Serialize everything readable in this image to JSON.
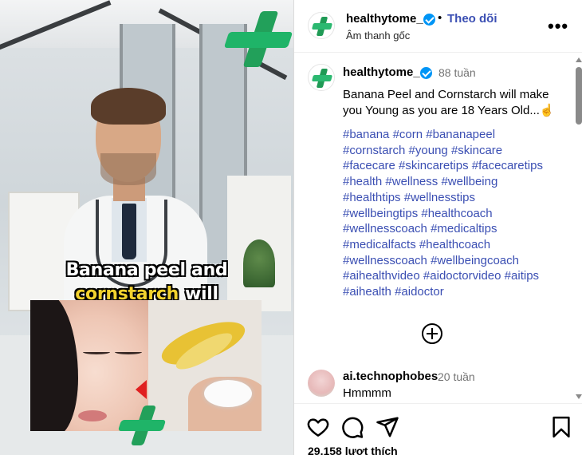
{
  "post": {
    "username": "healthytome_",
    "follow_label": "Theo dõi",
    "audio_label": "Âm thanh gốc",
    "more_label": "•••",
    "separator": "•",
    "caption_time": "88 tuần",
    "caption": "Banana Peel and Cornstarch will make you Young as you are 18 Years Old...☝️",
    "hashtags": [
      "#banana",
      "#corn",
      "#bananapeel",
      "#cornstarch",
      "#young",
      "#skincare",
      "#facecare",
      "#skincaretips",
      "#facecaretips",
      "#health",
      "#wellness",
      "#wellbeing",
      "#healthtips",
      "#wellnesstips",
      "#wellbeingtips",
      "#healthcoach",
      "#wellnesscoach",
      "#medicaltips",
      "#medicalfacts",
      "#healthcoach",
      "#wellnesscoach",
      "#wellbeingcoach",
      "#aihealthvideo",
      "#aidoctorvideo",
      "#aitips",
      "#aihealth",
      "#aidoctor"
    ],
    "likes": "29.158 lượt thích"
  },
  "media_overlay": {
    "line1": "Banana peel and",
    "line2_highlight": "cornstarch",
    "line2_rest": "will"
  },
  "comment": {
    "username": "ai.technophobes",
    "time": "20 tuần",
    "text": "Hmmmm"
  },
  "icons": {
    "like": "heart-icon",
    "comment": "comment-bubble-icon",
    "share": "paper-plane-icon",
    "save": "bookmark-icon",
    "more_comments": "plus-circle-icon"
  },
  "colors": {
    "link": "#3b4fb3",
    "verified": "#0095f6",
    "brand_green": "#22a05a",
    "muted_text": "#737373"
  }
}
